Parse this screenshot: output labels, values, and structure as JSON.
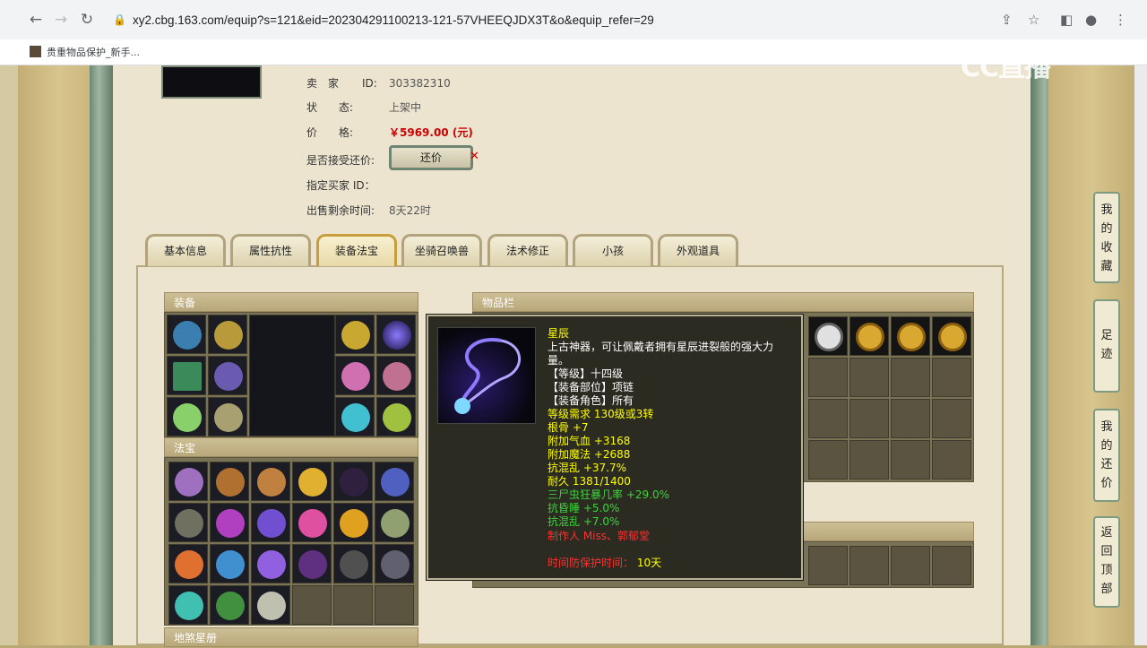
{
  "browser": {
    "url": "xy2.cbg.163.com/equip?s=121&eid=202304291100213-121-57VHEEQJDX3T&o&equip_refer=29",
    "bookmark": "贵重物品保护_新手..."
  },
  "watermark": "CC直播",
  "seller": {
    "rows": [
      {
        "label": "卖　家",
        "key": "ID:",
        "value": "303382310"
      },
      {
        "label": "状　　态:",
        "key": "",
        "value": "上架中"
      },
      {
        "label": "价　　格:",
        "key": "",
        "value": "￥5969.00 (元)"
      },
      {
        "label": "是否接受还价:",
        "key": "",
        "value": ""
      },
      {
        "label": "指定买家 ID：",
        "key": "",
        "value": ""
      },
      {
        "label": "出售剩余时间:",
        "key": "",
        "value": "8天22时"
      }
    ],
    "haggle_label": "还价"
  },
  "tabs": [
    "基本信息",
    "属性抗性",
    "装备法宝",
    "坐骑召唤兽",
    "法术修正",
    "小孩",
    "外观道具"
  ],
  "active_tab": 2,
  "sections": {
    "equip": "装备",
    "fabao": "法宝",
    "items": "物品栏",
    "disha": "地煞星册"
  },
  "tooltip": {
    "name": "星辰",
    "desc1": "上古神器，可让佩戴者拥有星辰进裂般的强大力",
    "desc2": "量。",
    "level": "【等级】十四级",
    "slot": "【装备部位】项链",
    "role": "【装备角色】所有",
    "req": "等级需求 130级或3转",
    "attrs": [
      "根骨 +7",
      "附加气血 +3168",
      "附加魔法 +2688",
      "抗混乱 +37.7%",
      "耐久 1381/1400"
    ],
    "green": [
      "三尸虫狂暴几率 +29.0%",
      "抗昏睡 +5.0%",
      "抗混乱 +7.0%"
    ],
    "maker": "制作人 Miss、郭郁堂",
    "protect_label": "时间防保护时间：",
    "protect_value": "10天"
  },
  "side_buttons": [
    [
      "我",
      "的",
      "收",
      "藏"
    ],
    [
      "足",
      "迹"
    ],
    [
      "我",
      "的",
      "还",
      "价"
    ],
    [
      "返",
      "回",
      "顶",
      "部"
    ]
  ]
}
